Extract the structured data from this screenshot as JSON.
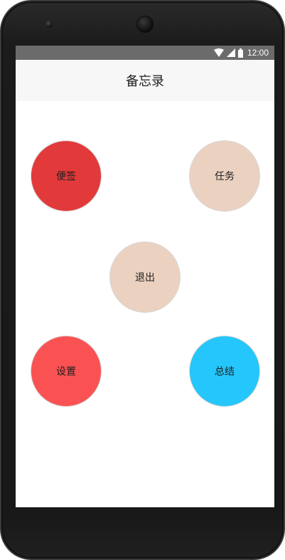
{
  "status_bar": {
    "time": "12:00",
    "icons": [
      "wifi-icon",
      "signal-icon",
      "battery-icon"
    ]
  },
  "app_bar": {
    "title": "备忘录"
  },
  "buttons": {
    "note": {
      "label": "便签",
      "color": "#e23a3a"
    },
    "task": {
      "label": "任务",
      "color": "#ebd1bf"
    },
    "exit": {
      "label": "退出",
      "color": "#ebd1bf"
    },
    "settings": {
      "label": "设置",
      "color": "#fa5252"
    },
    "summary": {
      "label": "总结",
      "color": "#24c6fb"
    }
  },
  "colors": {
    "status_bar": "#6b6b6b",
    "app_bar": "#f7f7f7"
  }
}
